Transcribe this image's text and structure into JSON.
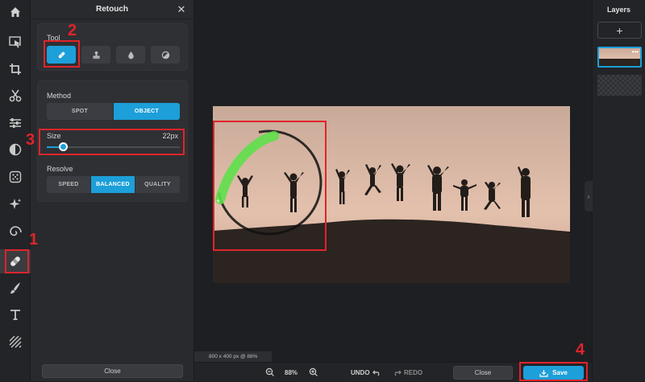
{
  "panel": {
    "title": "Retouch",
    "tool_label": "Tool",
    "method_label": "Method",
    "method_options": [
      "SPOT",
      "OBJECT"
    ],
    "method_selected": "OBJECT",
    "size_label": "Size",
    "size_value": "22px",
    "size_level": 0.12,
    "resolve_label": "Resolve",
    "resolve_options": [
      "SPEED",
      "BALANCED",
      "QUALITY"
    ],
    "resolve_selected": "BALANCED",
    "close_label": "Close"
  },
  "toolbar": {
    "items": [
      "home-icon",
      "select-arrow-icon",
      "crop-icon",
      "scissors-icon",
      "sliders-icon",
      "contrast-icon",
      "dots-grid-icon",
      "sparkle-icon",
      "spiral-icon",
      "bandage-icon",
      "brush-icon",
      "text-icon",
      "texture-icon"
    ],
    "active": "bandage-icon"
  },
  "canvas": {
    "info": "800 x 400 px @ 88%",
    "image_alt": "silhouettes of people jumping on a hill at sunset"
  },
  "bottombar": {
    "zoom": "88%",
    "undo_label": "UNDO",
    "redo_label": "REDO",
    "close_label": "Close",
    "save_label": "Save"
  },
  "layers": {
    "title": "Layers",
    "add_label": "+"
  },
  "annotations": [
    "1",
    "2",
    "3",
    "4"
  ],
  "colors": {
    "accent": "#1d9fd9",
    "annotation": "#e0242b",
    "brush": "#5ee04a"
  }
}
